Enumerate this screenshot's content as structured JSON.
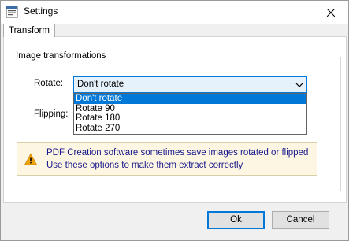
{
  "window": {
    "title": "Settings"
  },
  "tabs": [
    {
      "label": "Transform"
    }
  ],
  "group": {
    "title": "Image transformations"
  },
  "rotate": {
    "label": "Rotate:",
    "selected": "Don't rotate",
    "options": [
      "Don't rotate",
      "Rotate 90",
      "Rotate 180",
      "Rotate 270"
    ]
  },
  "flipping": {
    "label": "Flipping:"
  },
  "info": {
    "line1": "PDF Creation software sometimes save images rotated or flipped",
    "line2": "Use these options to make them extract correctly",
    "icon": "warning-icon"
  },
  "buttons": {
    "ok": "Ok",
    "cancel": "Cancel"
  },
  "colors": {
    "accent": "#0078d7",
    "info_bg": "#fdf6e3",
    "warning": "#f0a30a",
    "info_text": "#1a1a8c"
  }
}
